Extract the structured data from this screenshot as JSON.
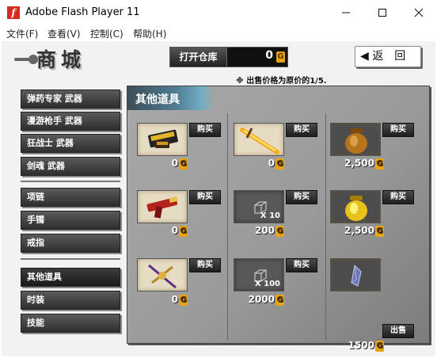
{
  "window": {
    "title": "Adobe Flash Player 11",
    "controls": {
      "minimize": "─",
      "maximize": "☐",
      "close": "✕"
    }
  },
  "menu": [
    "文件(F)",
    "查看(V)",
    "控制(C)",
    "帮助(H)"
  ],
  "shop": {
    "title": "商城",
    "warehouse_label": "打开仓库",
    "warehouse_value": "0",
    "back_label": "◀ 返　回",
    "note": "※ 出售价格为原价的1/5.",
    "gold_symbol": "G"
  },
  "nav_groups": [
    [
      "弹药专家 武器",
      "漫游枪手 武器",
      "狂战士 武器",
      "剑魂 武器"
    ],
    [
      "项链",
      "手镯",
      "戒指"
    ],
    [
      "其他道具",
      "时装",
      "技能"
    ]
  ],
  "panel": {
    "title": "其他道具"
  },
  "items": [
    {
      "icon": "gun-shells-icon",
      "action": "购买",
      "price": "0",
      "count": ""
    },
    {
      "icon": "golden-sword-icon",
      "action": "购买",
      "price": "0",
      "count": ""
    },
    {
      "icon": "clay-jar-icon",
      "action": "购买",
      "price": "2,500",
      "count": ""
    },
    {
      "icon": "red-blaster-icon",
      "action": "购买",
      "price": "0",
      "count": ""
    },
    {
      "icon": "cube-icon",
      "action": "购买",
      "price": "200",
      "count": "X 10"
    },
    {
      "icon": "golden-jar-icon",
      "action": "购买",
      "price": "2,500",
      "count": ""
    },
    {
      "icon": "cross-staff-icon",
      "action": "购买",
      "price": "0",
      "count": ""
    },
    {
      "icon": "cube-icon",
      "action": "购买",
      "price": "2000",
      "count": "X 100"
    },
    {
      "icon": "crystal-icon",
      "action": "出售",
      "price": "1500",
      "count": ""
    }
  ]
}
